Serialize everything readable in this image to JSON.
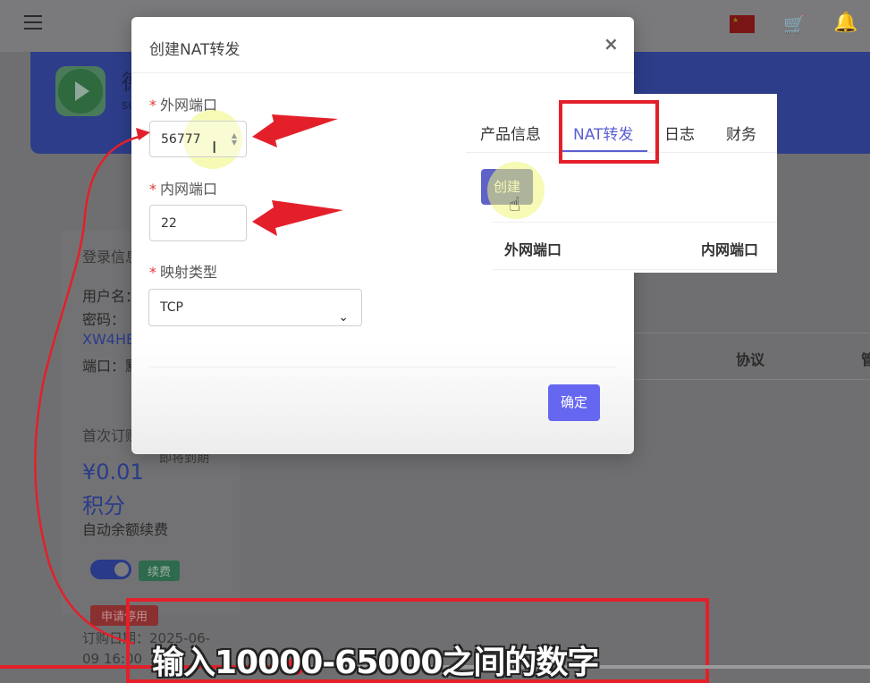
{
  "background": {
    "banner_title": "德",
    "banner_sub": "su",
    "login_info_label": "登录信息",
    "username_label": "用户名：",
    "password_label": "密码：",
    "password_value": "XW4HB",
    "port_label": "端口：",
    "port_value": "默",
    "first_order_label": "首次订购",
    "expiring_label": "即将到期",
    "price": "¥0.01",
    "points": "积分",
    "auto_renew": "自动余额续费",
    "renew_tag": "续费",
    "apply_tag": "申请停用",
    "order_date_label": "订购日期：2025-06-",
    "order_date_cont": "09 16:00",
    "protocol_col": "协议",
    "manage_col": "管"
  },
  "modal": {
    "title": "创建NAT转发",
    "close_icon": "×",
    "required_mark": "*",
    "external_port_label": "外网端口",
    "external_port_value": "56777",
    "internal_port_label": "内网端口",
    "internal_port_value": "22",
    "mapping_type_label": "映射类型",
    "mapping_type_value": "TCP",
    "confirm_label": "确定"
  },
  "inset": {
    "tabs": [
      "产品信息",
      "NAT转发",
      "日志",
      "财务"
    ],
    "active_tab": 1,
    "create_label": "创建",
    "col_external": "外网端口",
    "col_internal": "内网端口"
  },
  "subtitle": "输入10000-65000之间的数字",
  "colors": {
    "accent": "#6567f0",
    "annotation_red": "#e3202a",
    "required_red": "#e23636"
  },
  "video_progress": 0.34
}
